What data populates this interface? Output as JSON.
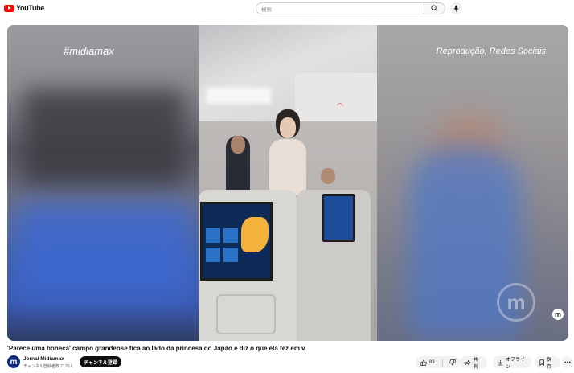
{
  "header": {
    "logo_text": "YouTube",
    "search_placeholder": "検索"
  },
  "video": {
    "watermark_left": "#midiamax",
    "watermark_right": "Reprodução, Redes Sociais",
    "watermark_logo": "m",
    "corner_logo": "m",
    "title": "'Parece uma boneca' campo grandense fica ao lado da princesa do Japão e diz o que ela fez em v"
  },
  "channel": {
    "name": "Jornal Midiamax",
    "subscribers": "チャンネル登録者数 7170人",
    "avatar_letter": "m",
    "subscribe_label": "チャンネル登録"
  },
  "actions": {
    "like_count": "83",
    "share_label": "共有",
    "offline_label": "オフライン",
    "save_label": "保存"
  }
}
